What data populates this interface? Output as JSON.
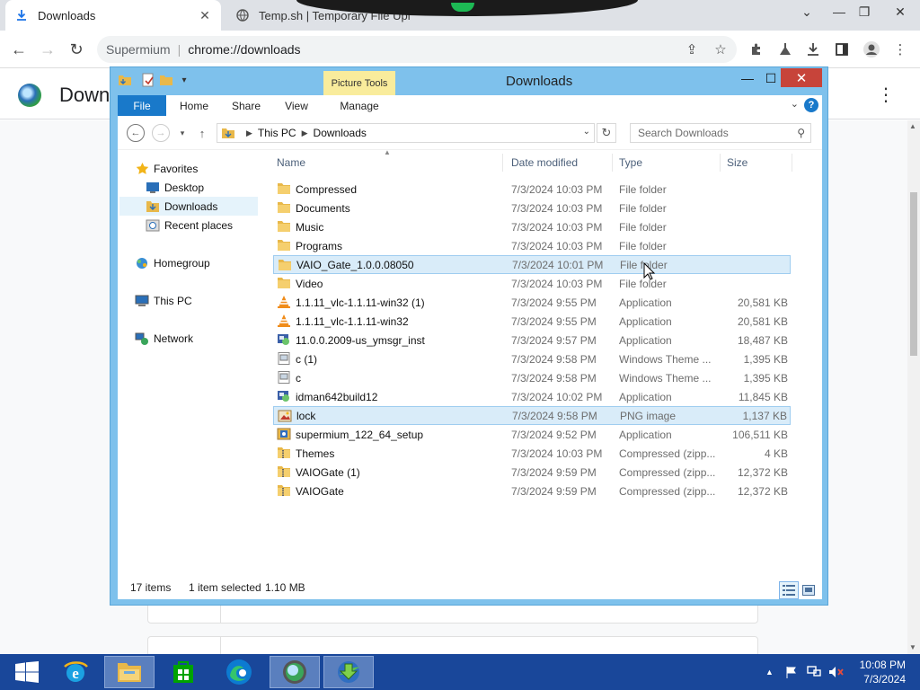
{
  "browser": {
    "tabs": [
      {
        "title": "Downloads",
        "active": true
      },
      {
        "title": "Temp.sh | Temporary File Upl",
        "active": false
      }
    ],
    "omnibox": {
      "brand": "Supermium",
      "url": "chrome://downloads"
    },
    "page_title": "Downl"
  },
  "explorer": {
    "title": "Downloads",
    "context_tab": "Picture Tools",
    "ribbon_tabs": [
      "File",
      "Home",
      "Share",
      "View",
      "Manage"
    ],
    "breadcrumb": [
      "This PC",
      "Downloads"
    ],
    "search_placeholder": "Search Downloads",
    "nav": {
      "favorites": "Favorites",
      "desktop": "Desktop",
      "downloads": "Downloads",
      "recent": "Recent places",
      "homegroup": "Homegroup",
      "this_pc": "This PC",
      "network": "Network"
    },
    "columns": {
      "name": "Name",
      "date": "Date modified",
      "type": "Type",
      "size": "Size"
    },
    "files": [
      {
        "name": "Compressed",
        "date": "7/3/2024 10:03 PM",
        "type": "File folder",
        "size": "",
        "icon": "folder-icon"
      },
      {
        "name": "Documents",
        "date": "7/3/2024 10:03 PM",
        "type": "File folder",
        "size": "",
        "icon": "folder-icon"
      },
      {
        "name": "Music",
        "date": "7/3/2024 10:03 PM",
        "type": "File folder",
        "size": "",
        "icon": "folder-icon"
      },
      {
        "name": "Programs",
        "date": "7/3/2024 10:03 PM",
        "type": "File folder",
        "size": "",
        "icon": "folder-icon"
      },
      {
        "name": "VAIO_Gate_1.0.0.08050",
        "date": "7/3/2024 10:01 PM",
        "type": "File folder",
        "size": "",
        "icon": "folder-icon"
      },
      {
        "name": "Video",
        "date": "7/3/2024 10:03 PM",
        "type": "File folder",
        "size": "",
        "icon": "folder-icon"
      },
      {
        "name": "1.1.11_vlc-1.1.11-win32 (1)",
        "date": "7/3/2024 9:55 PM",
        "type": "Application",
        "size": "20,581 KB",
        "icon": "vlc-icon"
      },
      {
        "name": "1.1.11_vlc-1.1.11-win32",
        "date": "7/3/2024 9:55 PM",
        "type": "Application",
        "size": "20,581 KB",
        "icon": "vlc-icon"
      },
      {
        "name": "11.0.0.2009-us_ymsgr_inst",
        "date": "7/3/2024 9:57 PM",
        "type": "Application",
        "size": "18,487 KB",
        "icon": "installer-icon"
      },
      {
        "name": "c (1)",
        "date": "7/3/2024 9:58 PM",
        "type": "Windows Theme ...",
        "size": "1,395 KB",
        "icon": "theme-file-icon"
      },
      {
        "name": "c",
        "date": "7/3/2024 9:58 PM",
        "type": "Windows Theme ...",
        "size": "1,395 KB",
        "icon": "theme-file-icon"
      },
      {
        "name": "idman642build12",
        "date": "7/3/2024 10:02 PM",
        "type": "Application",
        "size": "11,845 KB",
        "icon": "installer-icon"
      },
      {
        "name": "lock",
        "date": "7/3/2024 9:58 PM",
        "type": "PNG image",
        "size": "1,137 KB",
        "icon": "image-file-icon"
      },
      {
        "name": "supermium_122_64_setup",
        "date": "7/3/2024 9:52 PM",
        "type": "Application",
        "size": "106,511 KB",
        "icon": "setup-icon"
      },
      {
        "name": "Themes",
        "date": "7/3/2024 10:03 PM",
        "type": "Compressed (zipp...",
        "size": "4 KB",
        "icon": "zip-folder-icon"
      },
      {
        "name": "VAIOGate (1)",
        "date": "7/3/2024 9:59 PM",
        "type": "Compressed (zipp...",
        "size": "12,372 KB",
        "icon": "zip-folder-icon"
      },
      {
        "name": "VAIOGate",
        "date": "7/3/2024 9:59 PM",
        "type": "Compressed (zipp...",
        "size": "12,372 KB",
        "icon": "zip-folder-icon"
      }
    ],
    "status": {
      "count": "17 items",
      "selected": "1 item selected",
      "size": "1.10 MB"
    }
  },
  "taskbar": {
    "time": "10:08 PM",
    "date": "7/3/2024"
  },
  "colors": {
    "taskbar": "#19479a",
    "explorer_frame": "#7ec1ec",
    "file_tab": "#1979ca",
    "close_button": "#c7443a",
    "selection": "#d9ecf9"
  }
}
